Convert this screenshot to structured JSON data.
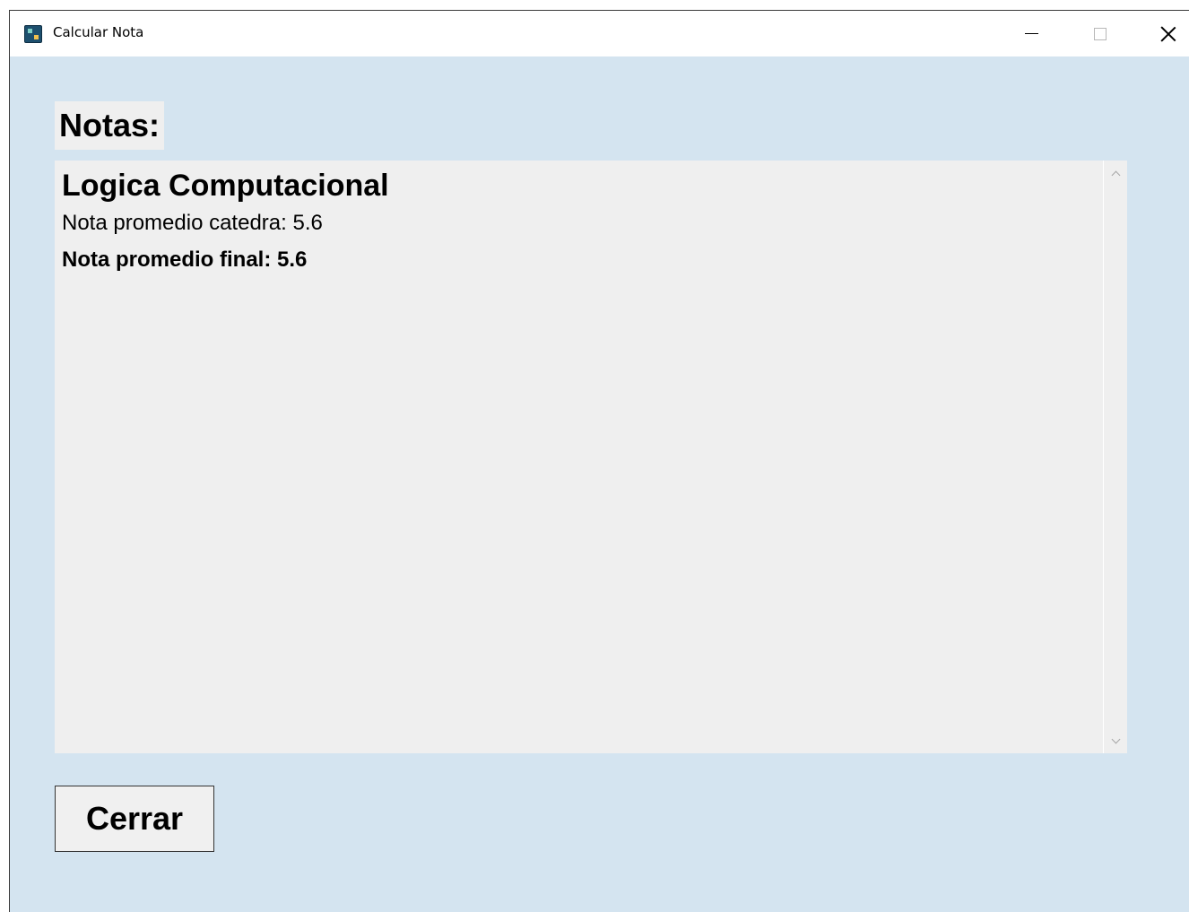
{
  "window": {
    "title": "Calcular Nota",
    "app_icon": "app-icon",
    "controls": {
      "minimize": "minimize-icon",
      "maximize": "maximize-icon",
      "close": "close-icon"
    }
  },
  "main": {
    "heading": "Notas:",
    "results": {
      "subject": "Logica Computacional",
      "catedra_line": "Nota promedio catedra: 5.6",
      "final_line": "Nota promedio final: 5.6"
    },
    "close_button_label": "Cerrar"
  },
  "colors": {
    "background": "#d4e4f0",
    "panel": "#efefef",
    "titlebar": "#ffffff"
  }
}
